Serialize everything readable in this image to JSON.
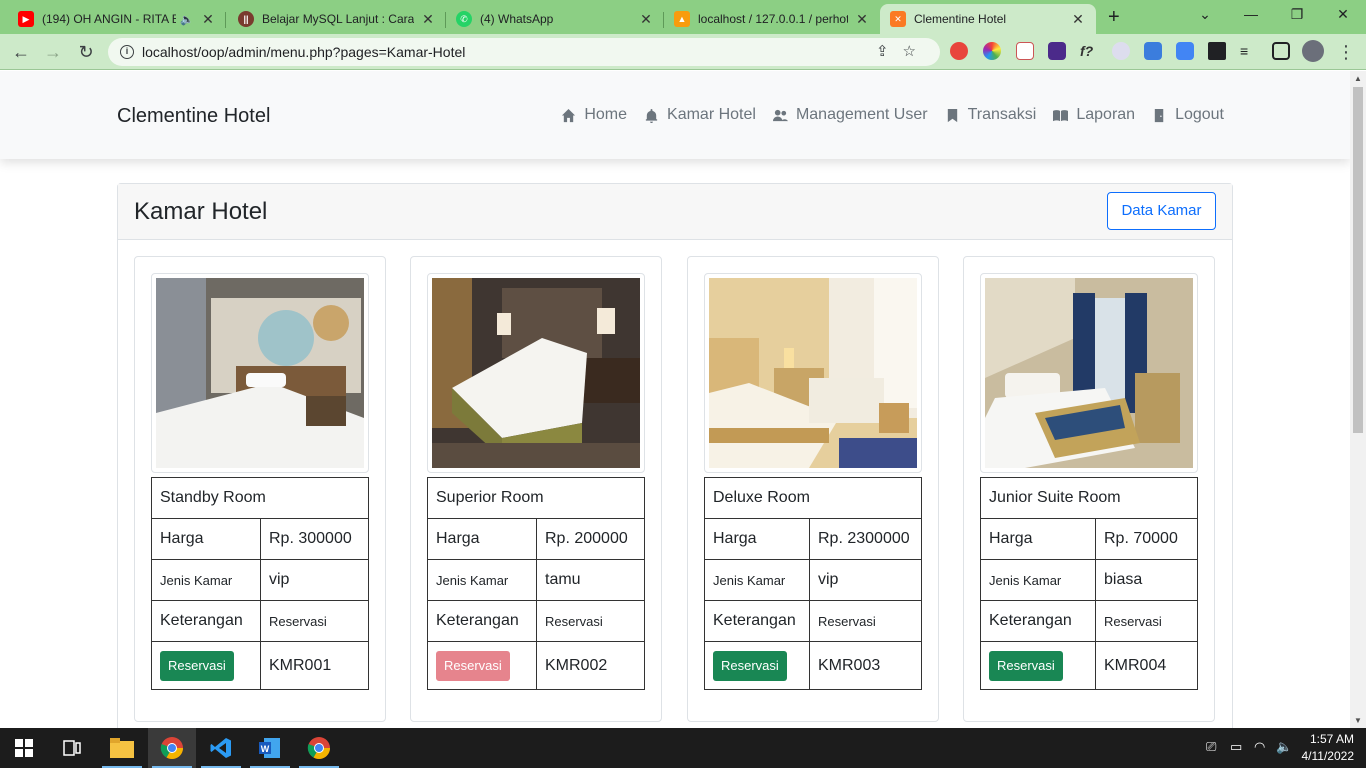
{
  "browser": {
    "tabs": [
      {
        "title": "(194) OH ANGIN - RITA E",
        "icon": "youtube-icon",
        "color": "#ff0000"
      },
      {
        "title": "Belajar MySQL Lanjut : Cara M",
        "icon": "site-icon",
        "color": "#7a3b2e"
      },
      {
        "title": "(4) WhatsApp",
        "icon": "whatsapp-icon",
        "color": "#25d366"
      },
      {
        "title": "localhost / 127.0.0.1 / perhot",
        "icon": "phpmyadmin-icon",
        "color": "#f89c0e"
      },
      {
        "title": "Clementine Hotel",
        "icon": "xampp-icon",
        "color": "#fb7a24"
      }
    ],
    "new_tab": "+",
    "url": "localhost/oop/admin/menu.php?pages=Kamar-Hotel"
  },
  "navbar": {
    "brand": "Clementine Hotel",
    "items": [
      {
        "label": "Home",
        "icon": "home-icon"
      },
      {
        "label": "Kamar Hotel",
        "icon": "bell-icon"
      },
      {
        "label": "Management User",
        "icon": "users-icon"
      },
      {
        "label": "Transaksi",
        "icon": "bookmark-icon"
      },
      {
        "label": "Laporan",
        "icon": "book-icon"
      },
      {
        "label": "Logout",
        "icon": "door-icon"
      }
    ]
  },
  "main": {
    "title": "Kamar Hotel",
    "data_button": "Data Kamar",
    "labels": {
      "harga": "Harga",
      "jenis": "Jenis Kamar",
      "keterangan": "Keterangan"
    },
    "rooms": [
      {
        "name": "Standby Room",
        "harga": "Rp. 300000",
        "jenis": "vip",
        "keterangan": "Reservasi",
        "button": "Reservasi",
        "button_color": "#198754",
        "kode": "KMR001"
      },
      {
        "name": "Superior Room",
        "harga": "Rp. 200000",
        "jenis": "tamu",
        "keterangan": "Reservasi",
        "button": "Reservasi",
        "button_color": "#e6848d",
        "kode": "KMR002"
      },
      {
        "name": "Deluxe Room",
        "harga": "Rp. 2300000",
        "jenis": "vip",
        "keterangan": "Reservasi",
        "button": "Reservasi",
        "button_color": "#198754",
        "kode": "KMR003"
      },
      {
        "name": "Junior Suite Room",
        "harga": "Rp. 70000",
        "jenis": "biasa",
        "keterangan": "Reservasi",
        "button": "Reservasi",
        "button_color": "#198754",
        "kode": "KMR004"
      }
    ]
  },
  "taskbar": {
    "time": "1:57 AM",
    "date": "4/11/2022"
  }
}
